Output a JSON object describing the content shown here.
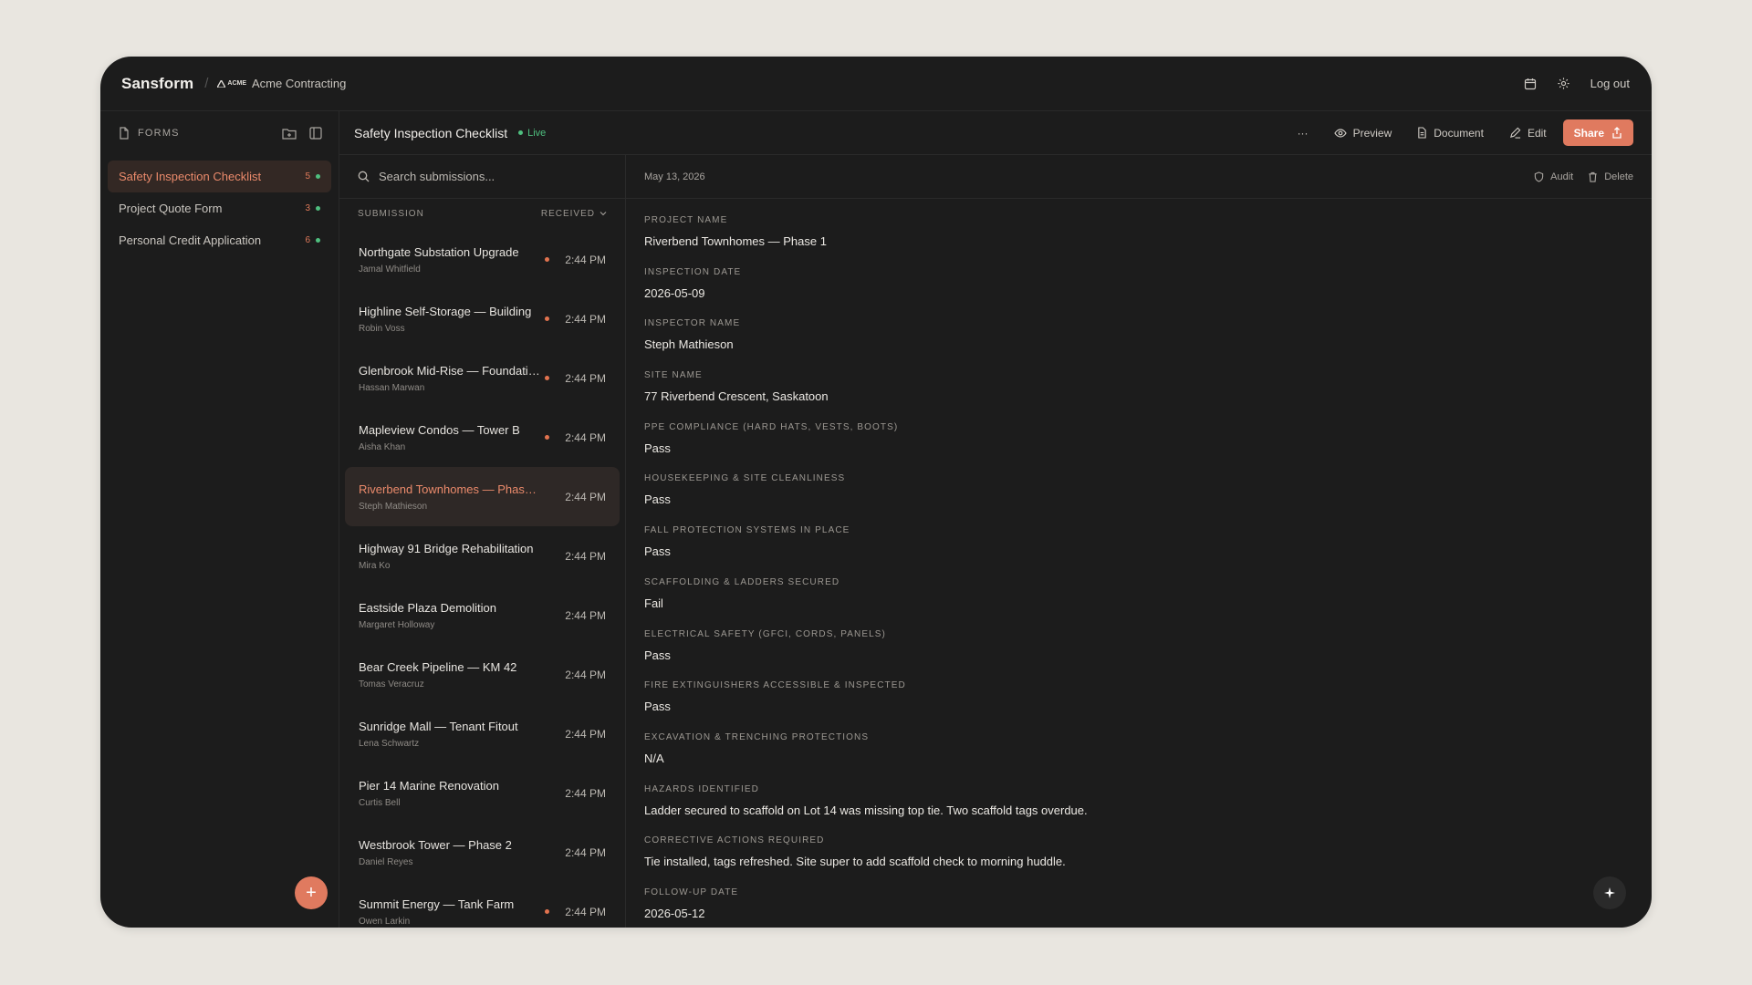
{
  "topbar": {
    "brand": "Sansform",
    "org_logo": "ACME",
    "org_name": "Acme Contracting",
    "logout": "Log out"
  },
  "sidebar": {
    "title": "FORMS",
    "forms": [
      {
        "label": "Safety Inspection Checklist",
        "count": "5",
        "active": true
      },
      {
        "label": "Project Quote Form",
        "count": "3",
        "active": false
      },
      {
        "label": "Personal Credit Application",
        "count": "6",
        "active": false
      }
    ]
  },
  "header": {
    "title": "Safety Inspection Checklist",
    "status": "Live",
    "more": "···",
    "preview": "Preview",
    "document": "Document",
    "edit": "Edit",
    "share": "Share"
  },
  "submissions": {
    "search_placeholder": "Search submissions...",
    "col_submission": "SUBMISSION",
    "col_received": "RECEIVED",
    "items": [
      {
        "name": "Northgate Substation Upgrade",
        "by": "Jamal Whitfield",
        "time": "2:44 PM",
        "unread": true
      },
      {
        "name": "Highline Self-Storage — Building",
        "by": "Robin Voss",
        "time": "2:44 PM",
        "unread": true
      },
      {
        "name": "Glenbrook Mid-Rise — Foundation",
        "by": "Hassan Marwan",
        "time": "2:44 PM",
        "unread": true
      },
      {
        "name": "Mapleview Condos — Tower B",
        "by": "Aisha Khan",
        "time": "2:44 PM",
        "unread": true
      },
      {
        "name": "Riverbend Townhomes — Phase 1",
        "by": "Steph Mathieson",
        "time": "2:44 PM",
        "unread": false,
        "active": true
      },
      {
        "name": "Highway 91 Bridge Rehabilitation",
        "by": "Mira Ko",
        "time": "2:44 PM",
        "unread": false
      },
      {
        "name": "Eastside Plaza Demolition",
        "by": "Margaret Holloway",
        "time": "2:44 PM",
        "unread": false
      },
      {
        "name": "Bear Creek Pipeline — KM 42",
        "by": "Tomas Veracruz",
        "time": "2:44 PM",
        "unread": false
      },
      {
        "name": "Sunridge Mall — Tenant Fitout",
        "by": "Lena Schwartz",
        "time": "2:44 PM",
        "unread": false
      },
      {
        "name": "Pier 14 Marine Renovation",
        "by": "Curtis Bell",
        "time": "2:44 PM",
        "unread": false
      },
      {
        "name": "Westbrook Tower — Phase 2",
        "by": "Daniel Reyes",
        "time": "2:44 PM",
        "unread": false
      },
      {
        "name": "Summit Energy — Tank Farm",
        "by": "Owen Larkin",
        "time": "2:44 PM",
        "unread": true
      }
    ]
  },
  "detail": {
    "date": "May 13, 2026",
    "audit": "Audit",
    "delete": "Delete",
    "fields": [
      {
        "label": "PROJECT NAME",
        "value": "Riverbend Townhomes — Phase 1"
      },
      {
        "label": "INSPECTION DATE",
        "value": "2026-05-09"
      },
      {
        "label": "INSPECTOR NAME",
        "value": "Steph Mathieson"
      },
      {
        "label": "SITE NAME",
        "value": "77 Riverbend Crescent, Saskatoon"
      },
      {
        "label": "PPE COMPLIANCE (HARD HATS, VESTS, BOOTS)",
        "value": "Pass"
      },
      {
        "label": "HOUSEKEEPING & SITE CLEANLINESS",
        "value": "Pass"
      },
      {
        "label": "FALL PROTECTION SYSTEMS IN PLACE",
        "value": "Pass"
      },
      {
        "label": "SCAFFOLDING & LADDERS SECURED",
        "value": "Fail"
      },
      {
        "label": "ELECTRICAL SAFETY (GFCI, CORDS, PANELS)",
        "value": "Pass"
      },
      {
        "label": "FIRE EXTINGUISHERS ACCESSIBLE & INSPECTED",
        "value": "Pass"
      },
      {
        "label": "EXCAVATION & TRENCHING PROTECTIONS",
        "value": "N/A"
      },
      {
        "label": "HAZARDS IDENTIFIED",
        "value": "Ladder secured to scaffold on Lot 14 was missing top tie. Two scaffold tags overdue."
      },
      {
        "label": "CORRECTIVE ACTIONS REQUIRED",
        "value": "Tie installed, tags refreshed. Site super to add scaffold check to morning huddle."
      },
      {
        "label": "FOLLOW-UP DATE",
        "value": "2026-05-12"
      }
    ]
  },
  "colors": {
    "accent": "#e07a5f",
    "live": "#4fbf7f",
    "background": "#1c1c1c"
  }
}
